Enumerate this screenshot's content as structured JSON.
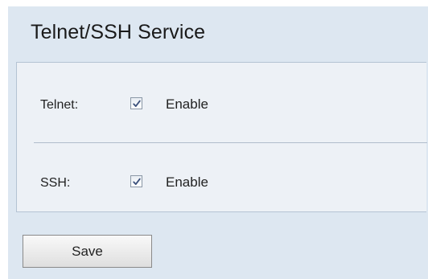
{
  "header": {
    "title": "Telnet/SSH Service"
  },
  "settings": {
    "telnet": {
      "label": "Telnet:",
      "checkbox_label": "Enable",
      "checked": true
    },
    "ssh": {
      "label": "SSH:",
      "checkbox_label": "Enable",
      "checked": true
    }
  },
  "actions": {
    "save_label": "Save"
  },
  "icons": {
    "checkmark": "checkmark-icon"
  },
  "colors": {
    "page_background": "#dde7f1",
    "panel_background": "#edf1f6",
    "checkmark": "#3a4f7a"
  }
}
